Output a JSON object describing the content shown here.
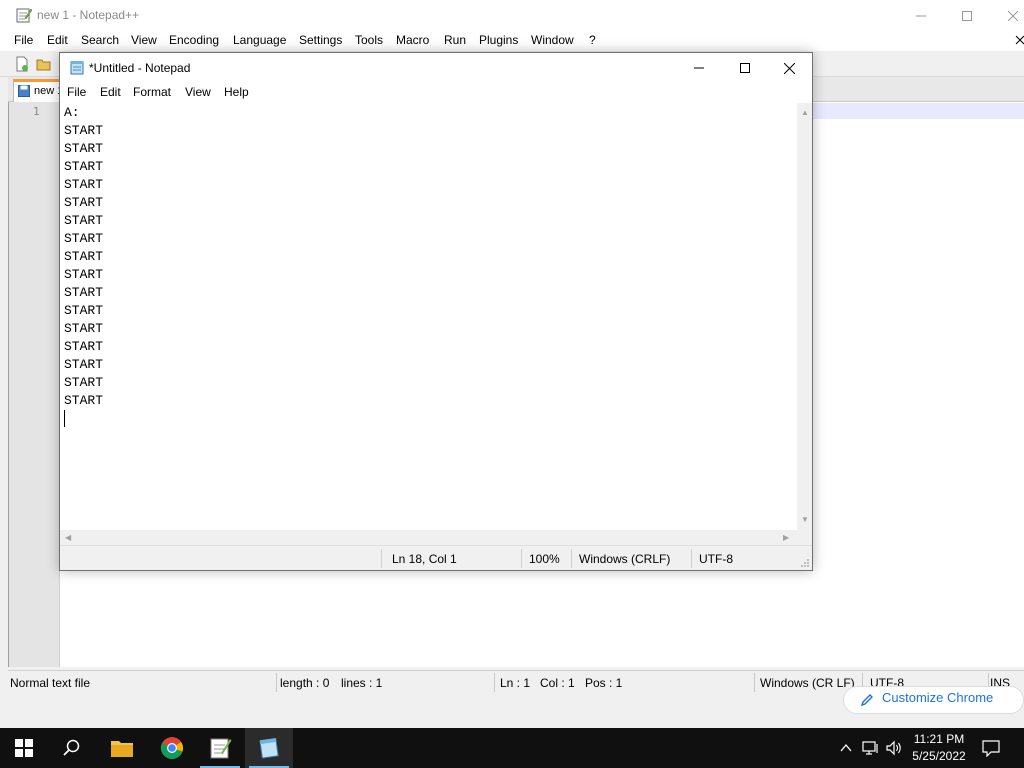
{
  "npp": {
    "title": "new 1 - Notepad++",
    "menu": [
      "File",
      "Edit",
      "Search",
      "View",
      "Encoding",
      "Language",
      "Settings",
      "Tools",
      "Macro",
      "Run",
      "Plugins",
      "Window",
      "?"
    ],
    "tab_label": "new 1",
    "line_number": "1",
    "status": {
      "file_type": "Normal text file",
      "length": "length : 0",
      "lines": "lines : 1",
      "ln": "Ln : 1",
      "col": "Col : 1",
      "pos": "Pos : 1",
      "eol": "Windows (CR LF)",
      "encoding": "UTF-8",
      "mode": "INS"
    }
  },
  "chrome_button": {
    "label": "Customize Chrome"
  },
  "notepad": {
    "title": "*Untitled - Notepad",
    "menu": [
      "File",
      "Edit",
      "Format",
      "View",
      "Help"
    ],
    "lines": [
      "A:",
      "START",
      "START",
      "START",
      "START",
      "START",
      "START",
      "START",
      "START",
      "START",
      "START",
      "START",
      "START",
      "START",
      "START",
      "START",
      "START"
    ],
    "status": {
      "position": "Ln 18, Col 1",
      "zoom": "100%",
      "eol": "Windows (CRLF)",
      "encoding": "UTF-8"
    }
  },
  "taskbar": {
    "apps": [
      "start",
      "search",
      "file-explorer",
      "chrome",
      "notepad-plus-plus",
      "notepad"
    ],
    "time": "11:21 PM",
    "date": "5/25/2022"
  },
  "colors": {
    "npp_tab_accent": "#f39c33",
    "chrome_accent": "#1a73e8",
    "taskbar": "#101010",
    "taskbar_indicator": "#76b9ed"
  }
}
